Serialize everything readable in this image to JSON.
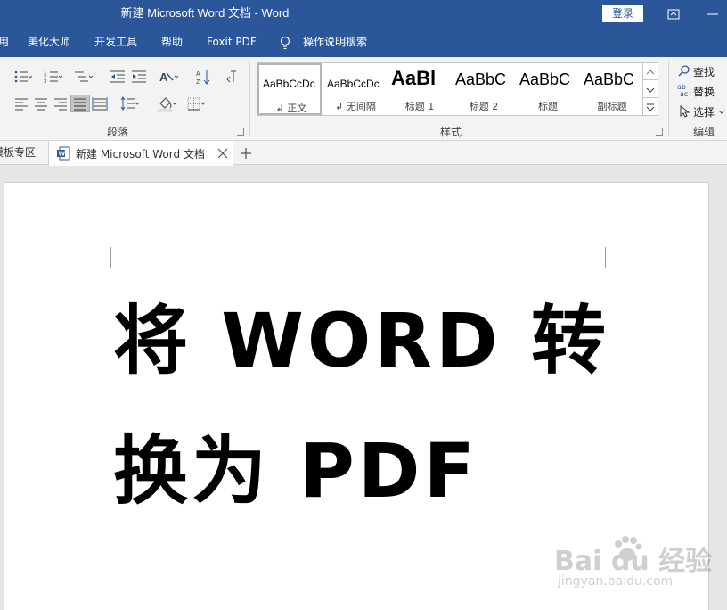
{
  "window": {
    "title": "新建 Microsoft Word 文档  -  Word",
    "login_label": "登录"
  },
  "menu": {
    "items": [
      "用",
      "美化大师",
      "开发工具",
      "帮助",
      "Foxit PDF"
    ],
    "tell_me": "操作说明搜索"
  },
  "ribbon": {
    "paragraph_label": "段落",
    "styles_label": "样式",
    "editing_label": "编辑",
    "styles": [
      {
        "sample": "AaBbCcDc",
        "name": "正文",
        "prefix": "↲"
      },
      {
        "sample": "AaBbCcDc",
        "name": "无间隔",
        "prefix": "↲"
      },
      {
        "sample": "AaBl",
        "name": "标题 1",
        "prefix": ""
      },
      {
        "sample": "AaBbC",
        "name": "标题 2",
        "prefix": ""
      },
      {
        "sample": "AaBbC",
        "name": "标题",
        "prefix": ""
      },
      {
        "sample": "AaBbC",
        "name": "副标题",
        "prefix": ""
      }
    ],
    "find_label": "查找",
    "replace_label": "替换",
    "select_label": "选择"
  },
  "tabs": {
    "previous": "模板专区",
    "active": "新建 Microsoft Word 文档"
  },
  "document": {
    "line1": "将 WORD 转",
    "line2": "换为 PDF"
  },
  "watermark": {
    "brand": "Bai du 经验",
    "url": "jingyan.baidu.com"
  },
  "colors": {
    "accent": "#2b579a",
    "ribbon_bg": "#f3f3f3"
  }
}
